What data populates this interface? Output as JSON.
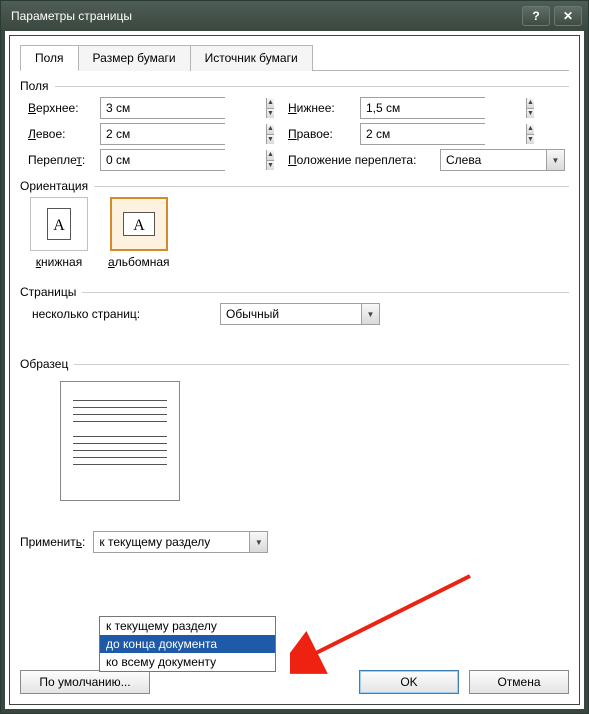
{
  "title": "Параметры страницы",
  "tabs": [
    "Поля",
    "Размер бумаги",
    "Источник бумаги"
  ],
  "active_tab": 0,
  "group_margins": "Поля",
  "margins": {
    "top_label": "Верхнее:",
    "top_value": "3 см",
    "bottom_label": "Нижнее:",
    "bottom_value": "1,5 см",
    "left_label": "Левое:",
    "left_value": "2 см",
    "right_label": "Правое:",
    "right_value": "2 см",
    "gutter_label": "Переплет:",
    "gutter_value": "0 см",
    "gutter_pos_label": "Положение переплета:",
    "gutter_pos_value": "Слева"
  },
  "group_orientation": "Ориентация",
  "orientation": {
    "portrait": "книжная",
    "landscape": "альбомная",
    "selected": "landscape"
  },
  "group_pages": "Страницы",
  "multi_pages_label": "несколько страниц:",
  "multi_pages_value": "Обычный",
  "group_preview": "Образец",
  "apply_label": "Применить:",
  "apply_value": "к текущему разделу",
  "apply_options": [
    "к текущему разделу",
    "до конца документа",
    "ко всему документу"
  ],
  "apply_highlight_index": 1,
  "buttons": {
    "default": "По умолчанию...",
    "ok": "OK",
    "cancel": "Отмена"
  }
}
